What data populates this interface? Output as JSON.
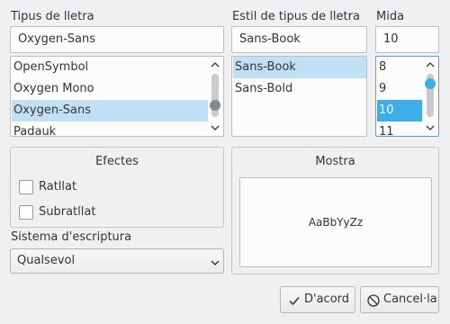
{
  "font_family": {
    "label": "Tipus de lletra",
    "value": "Oxygen-Sans",
    "options": [
      "OpenSymbol",
      "Oxygen Mono",
      "Oxygen-Sans",
      "Padauk"
    ],
    "selected": "Oxygen-Sans"
  },
  "font_style": {
    "label": "Estil de tipus de lletra",
    "value": "Sans-Book",
    "options": [
      "Sans-Book",
      "Sans-Bold"
    ],
    "selected": "Sans-Book"
  },
  "font_size": {
    "label": "Mida",
    "value": "10",
    "options": [
      "8",
      "9",
      "10",
      "11"
    ],
    "selected": "10"
  },
  "effects": {
    "title": "Efectes",
    "strikeout_label": "Ratllat",
    "strikeout_checked": false,
    "underline_label": "Subratllat",
    "underline_checked": false
  },
  "writing_system": {
    "label": "Sistema d'escriptura",
    "value": "Qualsevol"
  },
  "sample": {
    "title": "Mostra",
    "text": "AaBbYyZz"
  },
  "buttons": {
    "ok_label": "D'acord",
    "cancel_label": "Cancel·la"
  },
  "colors": {
    "window_bg": "#eff0f1",
    "field_bg": "#fcfcfc",
    "selection_bg": "#c2e0f5",
    "focus_accent": "#3daee9",
    "text": "#31363b"
  },
  "icons": {
    "ok": "check-icon",
    "cancel": "cancel-circle-icon",
    "combo": "chevron-down-icon",
    "scroll_up": "chevron-up-icon",
    "scroll_down": "chevron-down-icon"
  }
}
